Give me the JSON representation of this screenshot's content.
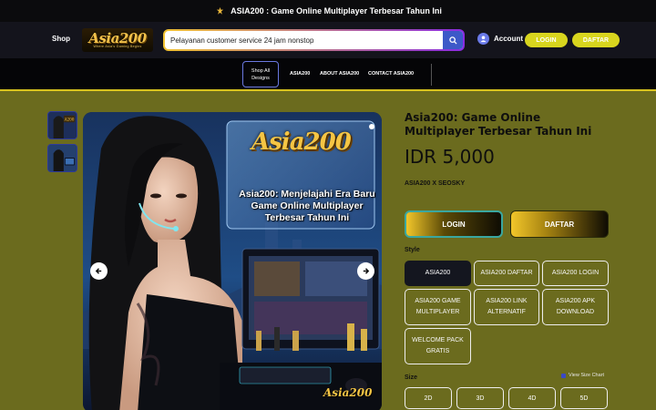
{
  "announcement": {
    "icon": "gift-icon",
    "text": "ASIA200 :  Game Online Multiplayer Terbesar Tahun Ini"
  },
  "header": {
    "shop_label": "Shop",
    "logo_text": "Asia200",
    "logo_tagline": "Where Asia's Gaming Begins",
    "search": {
      "value": "Pelayanan customer service 24 jam nonstop",
      "placeholder": "Pelayanan customer service 24 jam nonstop",
      "icon": "search-icon"
    },
    "account_label": "Account",
    "login_label": "LOGIN",
    "daftar_label": "DAFTAR"
  },
  "nav": {
    "category_button": "Shop All Designs",
    "links": [
      "ASIA200",
      "ABOUT ASIA200",
      "CONTACT ASIA200"
    ]
  },
  "hero": {
    "logo": "Asia200",
    "headline_lines": [
      "Asia200: Menjelajahi Era Baru",
      "Game Online Multiplayer",
      "Terbesar Tahun Ini"
    ],
    "brand_mark": "Asia200"
  },
  "product": {
    "title": "Asia200: Game Online Multiplayer Terbesar Tahun Ini",
    "price": "IDR 5,000",
    "vendor": "ASIA200 X SEOSKY",
    "login_button": "LOGIN",
    "daftar_button": "DAFTAR",
    "style_label": "Style",
    "style_options": [
      {
        "label": "ASIA200",
        "selected": true
      },
      {
        "label": "ASIA200 DAFTAR",
        "selected": false
      },
      {
        "label": "ASIA200 LOGIN",
        "selected": false
      },
      {
        "label": "ASIA200 GAME MULTIPLAYER",
        "selected": false
      },
      {
        "label": "ASIA200 LINK ALTERNATIF",
        "selected": false
      },
      {
        "label": "ASIA200 APK DOWNLOAD",
        "selected": false
      },
      {
        "label": "WELCOME PACK GRATIS",
        "selected": false
      }
    ],
    "size_label": "Size",
    "size_chart_label": "View Size Chart",
    "sizes": [
      "2D",
      "3D",
      "4D",
      "5D"
    ]
  },
  "colors": {
    "page_bg": "#6b6b1e",
    "header_bg": "#14141c",
    "accent_yellow": "#d8d51e",
    "search_button": "#3d59c8",
    "selected_variant": "#14161f"
  }
}
